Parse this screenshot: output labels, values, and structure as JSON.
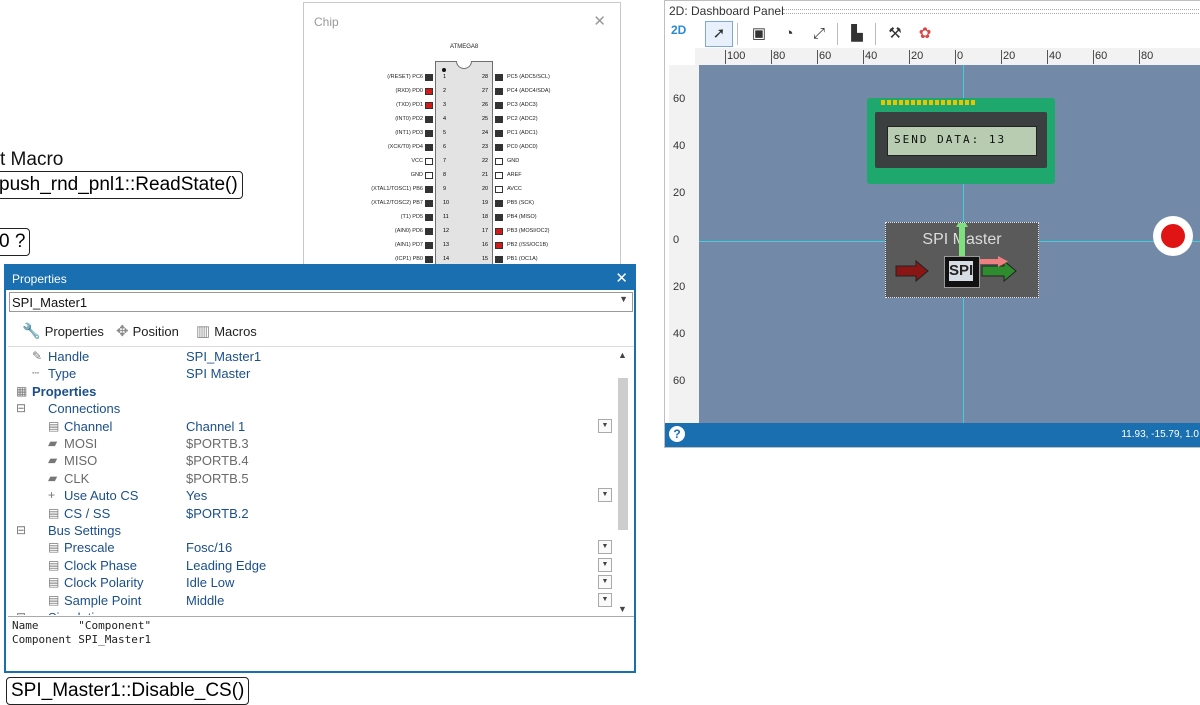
{
  "flowchart": {
    "macro_label": "t Macro",
    "call_1": "push_rnd_pnl1::ReadState()",
    "decision": "0 ?",
    "call_2": "SPI_Master1::Disable_CS()"
  },
  "chip": {
    "title": "Chip",
    "close": "✕",
    "part": "ATMEGA8",
    "left_pins": [
      {
        "num": "1",
        "label": "(/RESET) PC6",
        "color": "#333333"
      },
      {
        "num": "2",
        "label": "(RXD) PD0",
        "color": "#d11a1a"
      },
      {
        "num": "3",
        "label": "(TXD) PD1",
        "color": "#d11a1a"
      },
      {
        "num": "4",
        "label": "(INT0) PD2",
        "color": "#333333"
      },
      {
        "num": "5",
        "label": "(INT1) PD3",
        "color": "#333333"
      },
      {
        "num": "6",
        "label": "(XCK/T0) PD4",
        "color": "#333333"
      },
      {
        "num": "7",
        "label": "VCC",
        "color": "#ffffff"
      },
      {
        "num": "8",
        "label": "GND",
        "color": "#ffffff"
      },
      {
        "num": "9",
        "label": "(XTAL1/TOSC1) PB6",
        "color": "#333333"
      },
      {
        "num": "10",
        "label": "(XTAL2/TOSC2) PB7",
        "color": "#333333"
      },
      {
        "num": "11",
        "label": "(T1) PD5",
        "color": "#333333"
      },
      {
        "num": "12",
        "label": "(AIN0) PD6",
        "color": "#333333"
      },
      {
        "num": "13",
        "label": "(AIN1) PD7",
        "color": "#333333"
      },
      {
        "num": "14",
        "label": "(ICP1) PB0",
        "color": "#333333"
      }
    ],
    "right_pins": [
      {
        "num": "28",
        "label": "PC5 (ADC5/SCL)",
        "color": "#333333"
      },
      {
        "num": "27",
        "label": "PC4 (ADC4/SDA)",
        "color": "#333333"
      },
      {
        "num": "26",
        "label": "PC3 (ADC3)",
        "color": "#333333"
      },
      {
        "num": "25",
        "label": "PC2 (ADC2)",
        "color": "#333333"
      },
      {
        "num": "24",
        "label": "PC1 (ADC1)",
        "color": "#333333"
      },
      {
        "num": "23",
        "label": "PC0 (ADC0)",
        "color": "#333333"
      },
      {
        "num": "22",
        "label": "GND",
        "color": "#ffffff"
      },
      {
        "num": "21",
        "label": "AREF",
        "color": "#ffffff"
      },
      {
        "num": "20",
        "label": "AVCC",
        "color": "#ffffff"
      },
      {
        "num": "19",
        "label": "PB5 (SCK)",
        "color": "#333333"
      },
      {
        "num": "18",
        "label": "PB4 (MISO)",
        "color": "#333333"
      },
      {
        "num": "17",
        "label": "PB3 (MOSI/OC2)",
        "color": "#d11a1a"
      },
      {
        "num": "16",
        "label": "PB2 (/SS/OC1B)",
        "color": "#d11a1a"
      },
      {
        "num": "15",
        "label": "PB1 (OC1A)",
        "color": "#333333"
      }
    ]
  },
  "dashboard": {
    "title": "2D: Dashboard Panel",
    "mode_2d": "2D",
    "toolbar_icons": [
      "pointer-icon",
      "select-box-icon",
      "rotate-icon",
      "scale-icon",
      "camera-view-icon",
      "tools-icon",
      "colors-icon"
    ],
    "ruler_top": [
      "100",
      "80",
      "60",
      "40",
      "20",
      "0",
      "20",
      "40",
      "60",
      "80"
    ],
    "ruler_left": [
      "60",
      "40",
      "20",
      "0",
      "20",
      "40",
      "60"
    ],
    "lcd_text": "SEND DATA: 13",
    "spi_title": "SPI Master",
    "spi_chip_label": "SPI",
    "status_help": "?",
    "status_coords": "11.93, -15.79, 1.0"
  },
  "properties": {
    "title": "Properties",
    "close": "✕",
    "selected_component": "SPI_Master1",
    "tabs": [
      {
        "label": "Properties",
        "icon": "wrench-icon"
      },
      {
        "label": "Position",
        "icon": "move-icon"
      },
      {
        "label": "Macros",
        "icon": "macros-icon"
      }
    ],
    "rows": [
      {
        "name": "Handle",
        "value": "SPI_Master1",
        "kind": "item",
        "indent": 1,
        "dropdown": false
      },
      {
        "name": "Type",
        "value": "SPI Master",
        "kind": "item",
        "indent": 1,
        "dropdown": false
      },
      {
        "name": "Properties",
        "value": "",
        "kind": "section",
        "indent": 0,
        "dropdown": false
      },
      {
        "name": "Connections",
        "value": "",
        "kind": "group",
        "indent": 0,
        "dropdown": false
      },
      {
        "name": "Channel",
        "value": "Channel 1",
        "kind": "item",
        "indent": 2,
        "dropdown": true
      },
      {
        "name": "MOSI",
        "value": "$PORTB.3",
        "kind": "grey",
        "indent": 2,
        "dropdown": false
      },
      {
        "name": "MISO",
        "value": "$PORTB.4",
        "kind": "grey",
        "indent": 2,
        "dropdown": false
      },
      {
        "name": "CLK",
        "value": "$PORTB.5",
        "kind": "grey",
        "indent": 2,
        "dropdown": false
      },
      {
        "name": "Use Auto CS",
        "value": "Yes",
        "kind": "item",
        "indent": 2,
        "dropdown": true
      },
      {
        "name": "CS / SS",
        "value": "$PORTB.2",
        "kind": "item",
        "indent": 2,
        "dropdown": false
      },
      {
        "name": "Bus Settings",
        "value": "",
        "kind": "group",
        "indent": 0,
        "dropdown": false
      },
      {
        "name": "Prescale",
        "value": "Fosc/16",
        "kind": "item",
        "indent": 2,
        "dropdown": true
      },
      {
        "name": "Clock Phase",
        "value": "Leading Edge",
        "kind": "item",
        "indent": 2,
        "dropdown": true
      },
      {
        "name": "Clock Polarity",
        "value": "Idle Low",
        "kind": "item",
        "indent": 2,
        "dropdown": true
      },
      {
        "name": "Sample Point",
        "value": "Middle",
        "kind": "item",
        "indent": 2,
        "dropdown": true
      },
      {
        "name": "Simulation",
        "value": "",
        "kind": "group",
        "indent": 0,
        "dropdown": false
      }
    ],
    "desc_line1": "Name      \"Component\"",
    "desc_line2": "Component SPI_Master1"
  }
}
